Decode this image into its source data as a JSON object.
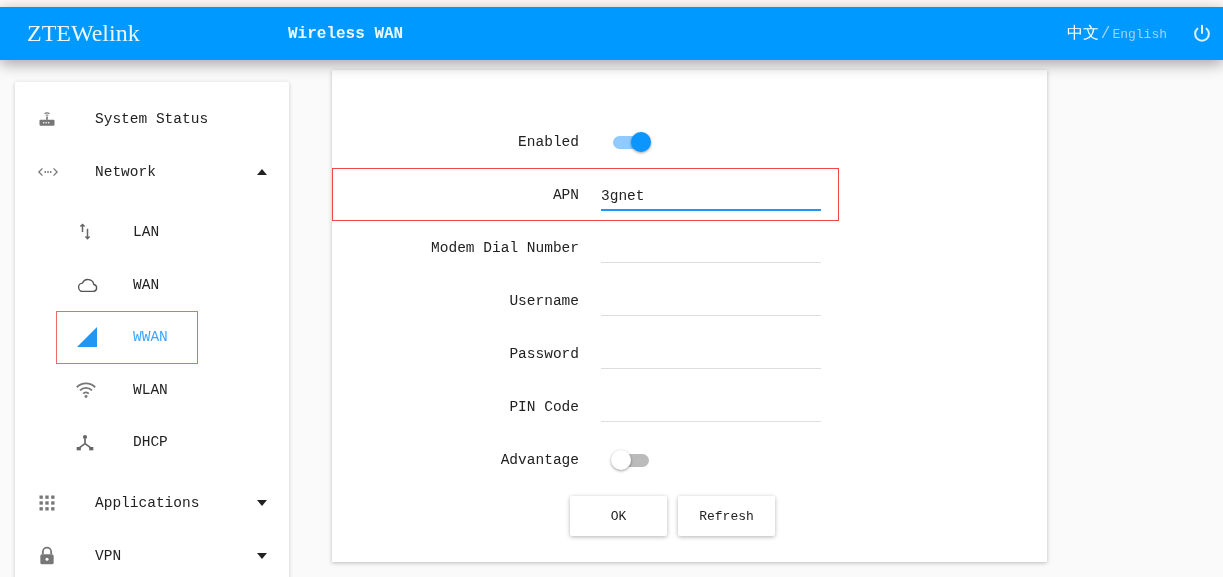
{
  "header": {
    "brand": "ZTEWelink",
    "page_title": "Wireless WAN",
    "languages": [
      {
        "label": "中文",
        "selected": true
      },
      {
        "label": "English",
        "selected": false
      }
    ],
    "language_separator": "/"
  },
  "sidebar": {
    "items": [
      {
        "label": "System Status"
      },
      {
        "label": "Network",
        "expanded": true,
        "children": [
          {
            "label": "LAN",
            "selected": false,
            "highlighted": false
          },
          {
            "label": "WAN",
            "selected": false,
            "highlighted": false
          },
          {
            "label": "WWAN",
            "selected": true,
            "highlighted": true
          },
          {
            "label": "WLAN",
            "selected": false,
            "highlighted": false
          },
          {
            "label": "DHCP",
            "selected": false,
            "highlighted": false
          }
        ]
      },
      {
        "label": "Applications",
        "expanded": false
      },
      {
        "label": "VPN",
        "expanded": false
      }
    ]
  },
  "form": {
    "rows": [
      {
        "kind": "switch",
        "label": "Enabled",
        "on": true
      },
      {
        "kind": "field",
        "label": "APN",
        "value": "3gnet",
        "focused": true,
        "highlighted": true
      },
      {
        "kind": "field",
        "label": "Modem Dial Number",
        "focused": false,
        "highlighted": false
      },
      {
        "kind": "field",
        "label": "Username",
        "focused": false,
        "highlighted": false
      },
      {
        "kind": "field",
        "label": "Password",
        "focused": false,
        "highlighted": false
      },
      {
        "kind": "field",
        "label": "PIN Code",
        "focused": false,
        "highlighted": false
      },
      {
        "kind": "switch",
        "label": "Advantage",
        "on": false
      }
    ],
    "buttons": [
      "OK",
      "Refresh"
    ]
  }
}
